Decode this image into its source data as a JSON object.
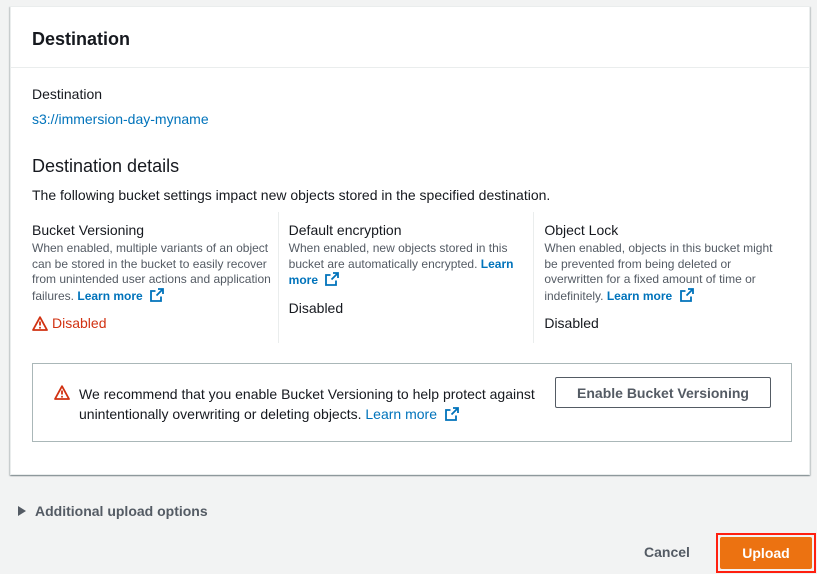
{
  "panel": {
    "title": "Destination",
    "destination_label": "Destination",
    "destination_link": "s3://immersion-day-myname",
    "details_title": "Destination details",
    "details_desc": "The following bucket settings impact new objects stored in the specified destination."
  },
  "settings": [
    {
      "title": "Bucket Versioning",
      "desc": "When enabled, multiple variants of an object can be stored in the bucket to easily recover from unintended user actions and application failures.",
      "learn_more": "Learn more",
      "status": "Disabled",
      "status_level": "warning"
    },
    {
      "title": "Default encryption",
      "desc": "When enabled, new objects stored in this bucket are automatically encrypted.",
      "learn_more": "Learn more",
      "status": "Disabled",
      "status_level": "normal"
    },
    {
      "title": "Object Lock",
      "desc": "When enabled, objects in this bucket might be prevented from being deleted or overwritten for a fixed amount of time or indefinitely.",
      "learn_more": "Learn more",
      "status": "Disabled",
      "status_level": "normal"
    }
  ],
  "alert": {
    "text": "We recommend that you enable Bucket Versioning to help protect against unintentionally overwriting or deleting objects.",
    "learn_more": "Learn more",
    "button": "Enable Bucket Versioning"
  },
  "footer": {
    "additional_options": "Additional upload options",
    "cancel": "Cancel",
    "upload": "Upload"
  },
  "colors": {
    "link": "#0073bb",
    "error": "#d13212",
    "primary": "#ec7211",
    "highlight": "#ff1f0f"
  },
  "icons": {
    "warning": "warning-icon",
    "external": "external-link-icon",
    "expand": "caret-right-icon"
  }
}
